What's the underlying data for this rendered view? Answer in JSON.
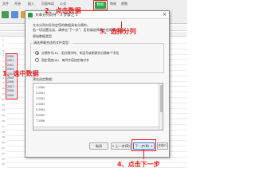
{
  "menu": [
    "文件",
    "开始",
    "插入",
    "页面布局",
    "公式",
    "数据",
    "审阅",
    "视图"
  ],
  "data_tab_label": "数据",
  "sheet": {
    "row_numbers": [
      "1",
      "2",
      "3",
      "4",
      "5",
      "6",
      "7",
      "8",
      "9",
      "10",
      "11",
      "12",
      "13",
      "14",
      "15",
      "16",
      "17",
      "18",
      "19",
      "20",
      "21",
      "22",
      "23",
      "24"
    ],
    "cell_values": [
      "2300",
      "2301",
      "2302",
      "2303",
      "2304",
      "2305",
      "2306",
      "2307",
      "2308",
      "2309"
    ]
  },
  "dialog": {
    "title": "文本分列向导 - 3 步骤之 1",
    "close": "×",
    "intro_1": "文本分列向导判定您的数据具有分隔符。",
    "intro_2": "若一切设置无误，请单击\"下一步\"，否则请选择最合适的数据类型。",
    "original_type_label": "原始数据类型",
    "choose_label": "请选择最合适的文件类型：",
    "option_delimited": "分隔符号(D) - 用分隔字符，如逗号或制表符分隔每个字段",
    "option_fixed": "固定宽度(W) - 每列字段加空格对齐",
    "preview_label": "预览选定数据：",
    "preview_rows": [
      "1 2300",
      "2 2301",
      "3 2302",
      "4 2303",
      "5 2304",
      "6 2305",
      "7 2306"
    ],
    "buttons": {
      "cancel": "取消",
      "back": "< 上一步(B)",
      "next": "下一步(N) >",
      "finish": "完成(F)"
    }
  },
  "annotations": {
    "step1": "1、选中数据",
    "step2": "2、点击数据",
    "step3": "3、选择分列",
    "step4": "4、点击下一步"
  },
  "colors": {
    "accent_red": "#e02020",
    "data_tab_green": "#22a744"
  }
}
